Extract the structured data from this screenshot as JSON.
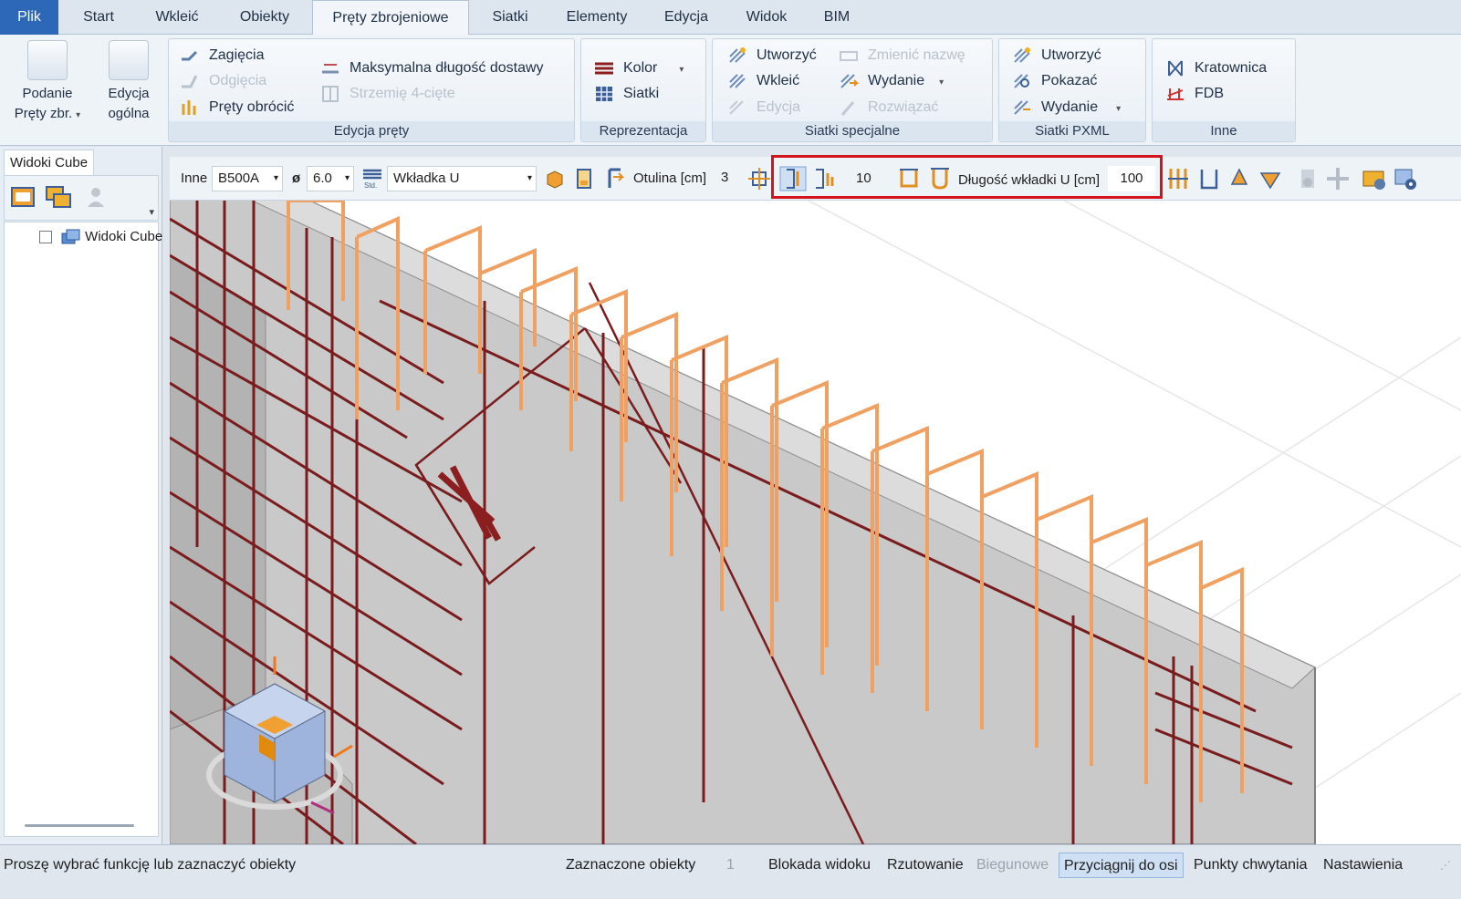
{
  "tabs": [
    {
      "label": "Plik"
    },
    {
      "label": "Start"
    },
    {
      "label": "Wkleić"
    },
    {
      "label": "Obiekty"
    },
    {
      "label": "Pręty zbrojeniowe"
    },
    {
      "label": "Siatki"
    },
    {
      "label": "Elementy"
    },
    {
      "label": "Edycja"
    },
    {
      "label": "Widok"
    },
    {
      "label": "BIM"
    }
  ],
  "ribbon": {
    "podanie": {
      "line1": "Podanie",
      "line2": "Pręty zbr."
    },
    "edycja_ogolna": {
      "line1": "Edycja",
      "line2": "ogólna"
    },
    "edycja_prety": {
      "zagiecia": "Zagięcia",
      "odgiecia": "Odgięcia",
      "prety_obrocic": "Pręty obrócić",
      "max_dlugosc": "Maksymalna długość dostawy",
      "strzemie": "Strzemię 4-cięte",
      "label": "Edycja pręty"
    },
    "reprezentacja": {
      "kolor": "Kolor",
      "siatki": "Siatki",
      "label": "Reprezentacja"
    },
    "siatki_specjalne": {
      "utworzyc": "Utworzyć",
      "wkleic": "Wkleić",
      "edycja": "Edycja",
      "zmienic_nazwe": "Zmienić nazwę",
      "wydanie": "Wydanie",
      "rozwiazac": "Rozwiązać",
      "label": "Siatki specjalne"
    },
    "siatki_pxml": {
      "utworzyc": "Utworzyć",
      "pokazac": "Pokazać",
      "wydanie": "Wydanie",
      "label": "Siatki PXML"
    },
    "inne": {
      "kratownica": "Kratownica",
      "fdb": "FDB",
      "label": "Inne"
    }
  },
  "left_panel": {
    "title": "Widoki Cube",
    "tree_item": "Widoki Cube"
  },
  "toolbar": {
    "inne": "Inne",
    "material": "B500A",
    "diameter_symbol": "ø",
    "diameter": "6.0",
    "std_icon_text": "Std.",
    "bar_type": "Wkładka U",
    "otulina_label": "Otulina [cm]",
    "otulina_value": "3",
    "spacing_value": "10",
    "dlugosc_label": "Długość wkładki U [cm]",
    "dlugosc_value": "100"
  },
  "status": {
    "message": "Proszę wybrać funkcję lub zaznaczyć obiekty",
    "zaznaczone": "Zaznaczone obiekty",
    "count": "1",
    "blokada": "Blokada widoku",
    "rzutowanie": "Rzutowanie",
    "biegunowe": "Biegunowe",
    "przyciagnij": "Przyciągnij do osi",
    "punkty": "Punkty chwytania",
    "nastawienia": "Nastawienia"
  },
  "colors": {
    "accent_blue": "#2d67b8",
    "highlight_red": "#d4141c",
    "rebar_dark": "#7a1c1e",
    "rebar_orange": "#f0a060"
  }
}
